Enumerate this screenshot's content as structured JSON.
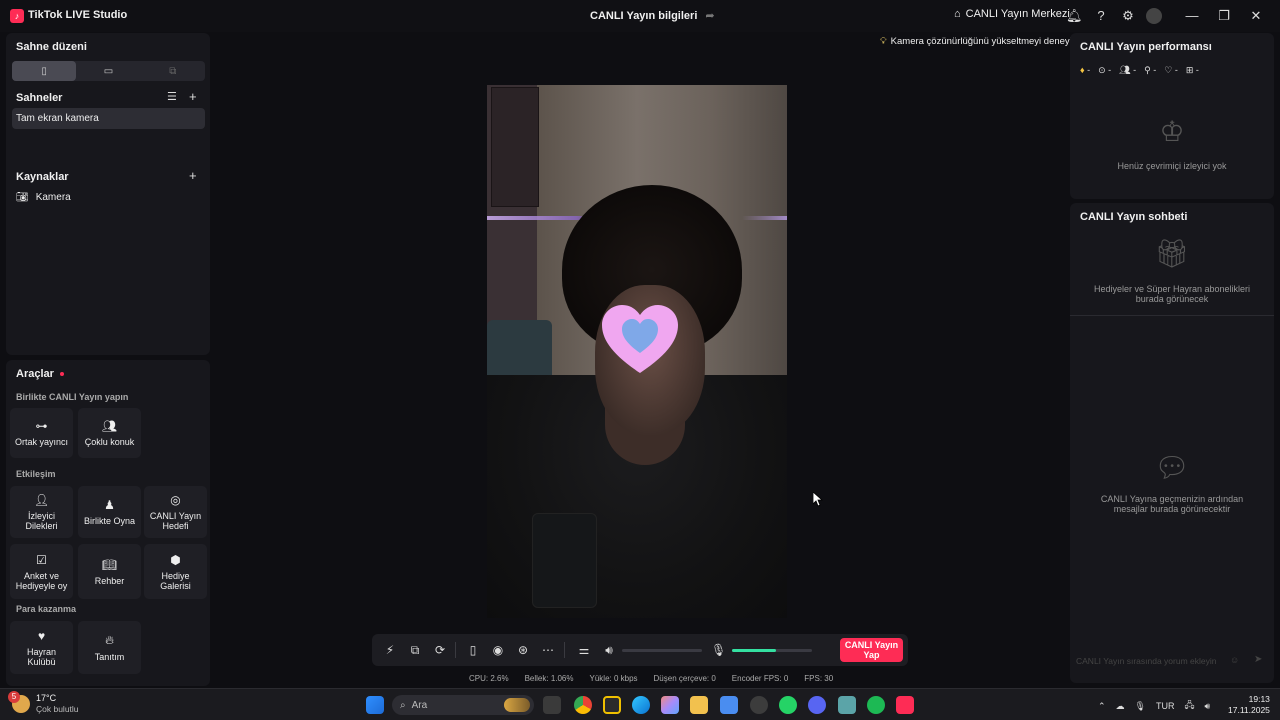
{
  "window": {
    "app_title": "TikTok LIVE Studio",
    "center_title": "CANLI Yayın bilgileri",
    "live_center": "CANLI Yayın Merkezi"
  },
  "left": {
    "layout_title": "Sahne düzeni",
    "scenes_title": "Sahneler",
    "scene_item": "Tam ekran kamera",
    "sources_title": "Kaynaklar",
    "source_item": "Kamera",
    "tools_title": "Araçlar",
    "sections": {
      "collab": "Birlikte CANLI Yayın yapın",
      "interaction": "Etkileşim",
      "monetization": "Para kazanma"
    },
    "tools": {
      "cohost": "Ortak yayıncı",
      "multiguest": "Çoklu konuk",
      "viewer_wishes_1": "İzleyici",
      "viewer_wishes_2": "Dilekleri",
      "play_together": "Birlikte Oyna",
      "live_goal_1": "CANLI Yayın",
      "live_goal_2": "Hedefi",
      "poll_1": "Anket ve",
      "poll_2": "Hediyeyle oy",
      "guide": "Rehber",
      "gift_gallery_1": "Hediye",
      "gift_gallery_2": "Galerisi",
      "fan_club_1": "Hayran",
      "fan_club_2": "Kulübü",
      "promote": "Tanıtım"
    }
  },
  "center": {
    "tip": "Kamera çözünürlüğünü yükseltmeyi deneyin",
    "go_live_1": "CANLI Yayın",
    "go_live_2": "Yap",
    "volume_level": 0,
    "mic_level": 0.55
  },
  "stats": {
    "cpu": "CPU:  2.6%",
    "memory": "Bellek:  1.06%",
    "upload": "Yükle:  0 kbps",
    "dropped": "Düşen çerçeve:  0",
    "encoder_fps": "Encoder FPS:  0",
    "fps": "FPS:  30"
  },
  "right": {
    "perf_title": "CANLI Yayın performansı",
    "metric_placeholder": "-",
    "no_viewers": "Henüz çevrimiçi izleyici yok",
    "chat_title": "CANLI Yayın sohbeti",
    "gifts_empty_1": "Hediyeler ve Süper Hayran abonelikleri",
    "gifts_empty_2": "burada görünecek",
    "messages_empty_1": "CANLI Yayına geçmenizin ardından",
    "messages_empty_2": "mesajlar burada görünecektir",
    "chat_placeholder": "CANLI Yayın sırasında yorum ekleyin"
  },
  "taskbar": {
    "weather_temp": "17°C",
    "weather_desc": "Çok bulutlu",
    "weather_badge": "5",
    "search_placeholder": "Ara",
    "language": "TUR",
    "time": "19:13",
    "date": "17.11.2025"
  },
  "colors": {
    "accent": "#fe2c55",
    "meter": "#34e0a1",
    "background": "#0e0e12",
    "panel": "#17171c"
  }
}
